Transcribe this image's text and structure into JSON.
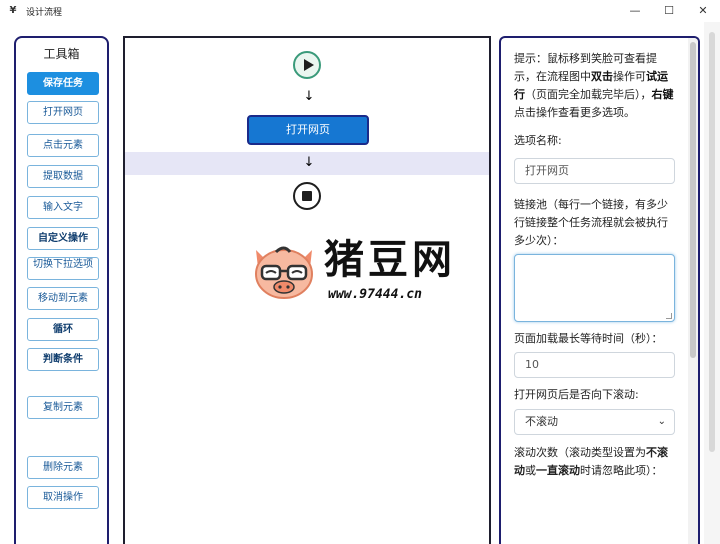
{
  "window": {
    "title": "设计流程",
    "app_icon": "¥",
    "minimize": "—",
    "maximize": "☐",
    "close": "✕"
  },
  "toolbox": {
    "title": "工具箱",
    "buttons": [
      {
        "label": "保存任务",
        "style": "primary"
      },
      {
        "label": "打开网页",
        "style": "normal"
      },
      {
        "label": "点击元素",
        "style": "normal"
      },
      {
        "label": "提取数据",
        "style": "normal"
      },
      {
        "label": "输入文字",
        "style": "normal"
      },
      {
        "label": "自定义操作",
        "style": "bold"
      },
      {
        "label": "切换下拉选项",
        "style": "wrap"
      },
      {
        "label": "移动到元素",
        "style": "normal"
      },
      {
        "label": "循环",
        "style": "bold"
      },
      {
        "label": "判断条件",
        "style": "bold"
      },
      {
        "label": "复制元素",
        "style": "normal"
      },
      {
        "label": "删除元素",
        "style": "normal"
      },
      {
        "label": "取消操作",
        "style": "normal"
      }
    ]
  },
  "flow": {
    "start_icon": "play-icon",
    "arrow": "↓",
    "node_label": "打开网页",
    "end_icon": "stop-icon"
  },
  "watermark": {
    "title": "猪豆网",
    "url": "www.97444.cn"
  },
  "options": {
    "hint_parts": [
      {
        "t": "提示：鼠标移到笑脸可查看提示，在流程图中",
        "b": false
      },
      {
        "t": "双击",
        "b": true
      },
      {
        "t": "操作可",
        "b": false
      },
      {
        "t": "试运行",
        "b": true
      },
      {
        "t": "（页面完全加载完毕后），",
        "b": false
      },
      {
        "t": "右键",
        "b": true
      },
      {
        "t": "点击操作查看更多选项。",
        "b": false
      }
    ],
    "name_label": "选项名称:",
    "name_value": "打开网页",
    "links_label": "链接池（每行一个链接，有多少行链接整个任务流程就会被执行多少次）：",
    "links_value": "",
    "wait_label": "页面加载最长等待时间（秒）：",
    "wait_value": "10",
    "scroll_label": "打开网页后是否向下滚动:",
    "scroll_value": "不滚动",
    "scroll_times_parts": [
      {
        "t": "滚动次数（滚动类型设置为",
        "b": false
      },
      {
        "t": "不滚动",
        "b": true
      },
      {
        "t": "或",
        "b": false
      },
      {
        "t": "一直滚动",
        "b": true
      },
      {
        "t": "时请忽略此项）：",
        "b": false
      }
    ]
  }
}
